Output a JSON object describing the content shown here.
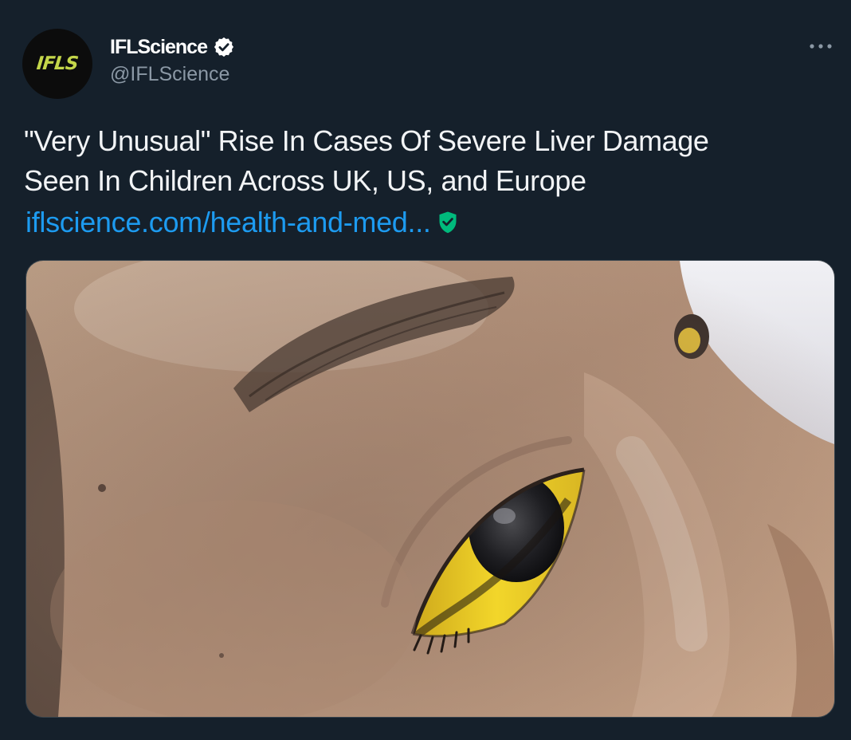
{
  "account": {
    "display_name": "IFLScience",
    "handle": "@IFLScience",
    "avatar_text": "IFLS",
    "verified_icon": "verified-badge-icon"
  },
  "menu": {
    "icon": "more-options-icon"
  },
  "tweet": {
    "text_lines": [
      "\"Very Unusual\" Rise In Cases Of Severe Liver Damage",
      "Seen In Children Across UK, US, and Europe"
    ],
    "link_text": "iflscience.com/health-and-med...",
    "link_safety_icon": "shield-check-icon"
  },
  "media": {
    "subject": "close-up of a child's eye with yellowed sclera"
  },
  "colors": {
    "background": "#15202b",
    "link": "#1d9bf0",
    "handle": "#8b98a5",
    "shield": "#00ba7c",
    "brand": "#c4d64a"
  }
}
